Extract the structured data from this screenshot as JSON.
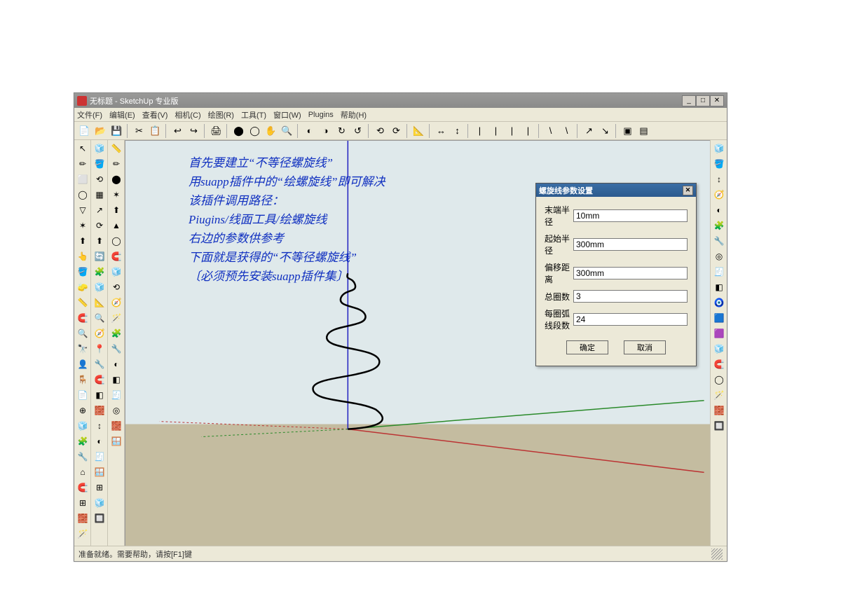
{
  "window": {
    "title": "无标题 - SketchUp 专业版"
  },
  "winbtns": {
    "min": "_",
    "max": "□",
    "close": "✕"
  },
  "menu": {
    "file": "文件(F)",
    "edit": "编辑(E)",
    "view": "查看(V)",
    "camera": "相机(C)",
    "draw": "绘图(R)",
    "tools": "工具(T)",
    "window": "窗口(W)",
    "plugins": "Plugins",
    "help": "帮助(H)"
  },
  "annotation": {
    "l1": "首先要建立“不等径螺旋线”",
    "l2": "用suapp插件中的“绘螺旋线”即可解决",
    "l3": "该插件调用路径：",
    "l4": "Piugins/线面工具/绘螺旋线",
    "l5": "右边的参数供参考",
    "l6": "下面就是获得的“不等径螺旋线”",
    "l7": "〔必须预先安装suapp插件集〕"
  },
  "dialog": {
    "title": "螺旋线参数设置",
    "closeGlyph": "✕",
    "fields": {
      "endRadius": {
        "label": "末端半径",
        "value": "10mm"
      },
      "startRadius": {
        "label": "起始半径",
        "value": "300mm"
      },
      "pitch": {
        "label": "偏移距离",
        "value": "300mm"
      },
      "turns": {
        "label": "总圈数",
        "value": "3"
      },
      "segments": {
        "label": "每圈弧线段数",
        "value": "24"
      }
    },
    "ok": "确定",
    "cancel": "取消"
  },
  "status": "准备就绪。需要帮助，请按[F1]键",
  "toolbar_icons": [
    "📄",
    "📂",
    "💾",
    "",
    "✂",
    "📋",
    "",
    "↩",
    "↪",
    "",
    "🖨",
    "",
    "⬤",
    "◯",
    "✋",
    "🔍",
    "",
    "◐",
    "◑",
    "↻",
    "↺",
    "",
    "⟲",
    "⟳",
    "",
    "📐",
    "",
    "↔",
    "↕",
    "",
    "|",
    "|",
    "|",
    "|",
    "",
    "\\",
    "\\",
    "",
    "↗",
    "↘",
    "",
    "▣",
    "▤"
  ],
  "left_col1": [
    "↖",
    "✏",
    "⬜",
    "◯",
    "▽",
    "✶",
    "⬆",
    "👆",
    "🪣",
    "🧽",
    "📏",
    "🧲",
    "🔍",
    "🔭",
    "👤",
    "🪑",
    "📄",
    "⊕",
    "🧊",
    "🧩",
    "🔧",
    "⌂",
    "🧲",
    "⊞",
    "🧱",
    "🪄"
  ],
  "left_col2": [
    "🧊",
    "🪣",
    "⟲",
    "▦",
    "↗",
    "⟳",
    "⬆",
    "🔄",
    "🧩",
    "🧊",
    "📐",
    "🔍",
    "🧭",
    "📍",
    "🔧",
    "🧲",
    "◧",
    "🧱",
    "↕",
    "◐",
    "🧾",
    "🪟",
    "⊞",
    "🧊",
    "🔲"
  ],
  "left_col3": [
    "📏",
    "✏",
    "⬤",
    "✶",
    "⬆",
    "▲",
    "◯",
    "🧲",
    "🧊",
    "⟲",
    "🧭",
    "🪄",
    "🧩",
    "🔧",
    "◐",
    "◧",
    "🧾",
    "◎",
    "🧱",
    "🪟"
  ],
  "right_col": [
    "🧊",
    "🪣",
    "↕",
    "🧭",
    "◐",
    "🧩",
    "🔧",
    "◎",
    "🧾",
    "◧",
    "🧿",
    "🟦",
    "🟪",
    "🧊",
    "🧲",
    "◯",
    "🪄",
    "🧱",
    "🔲"
  ]
}
